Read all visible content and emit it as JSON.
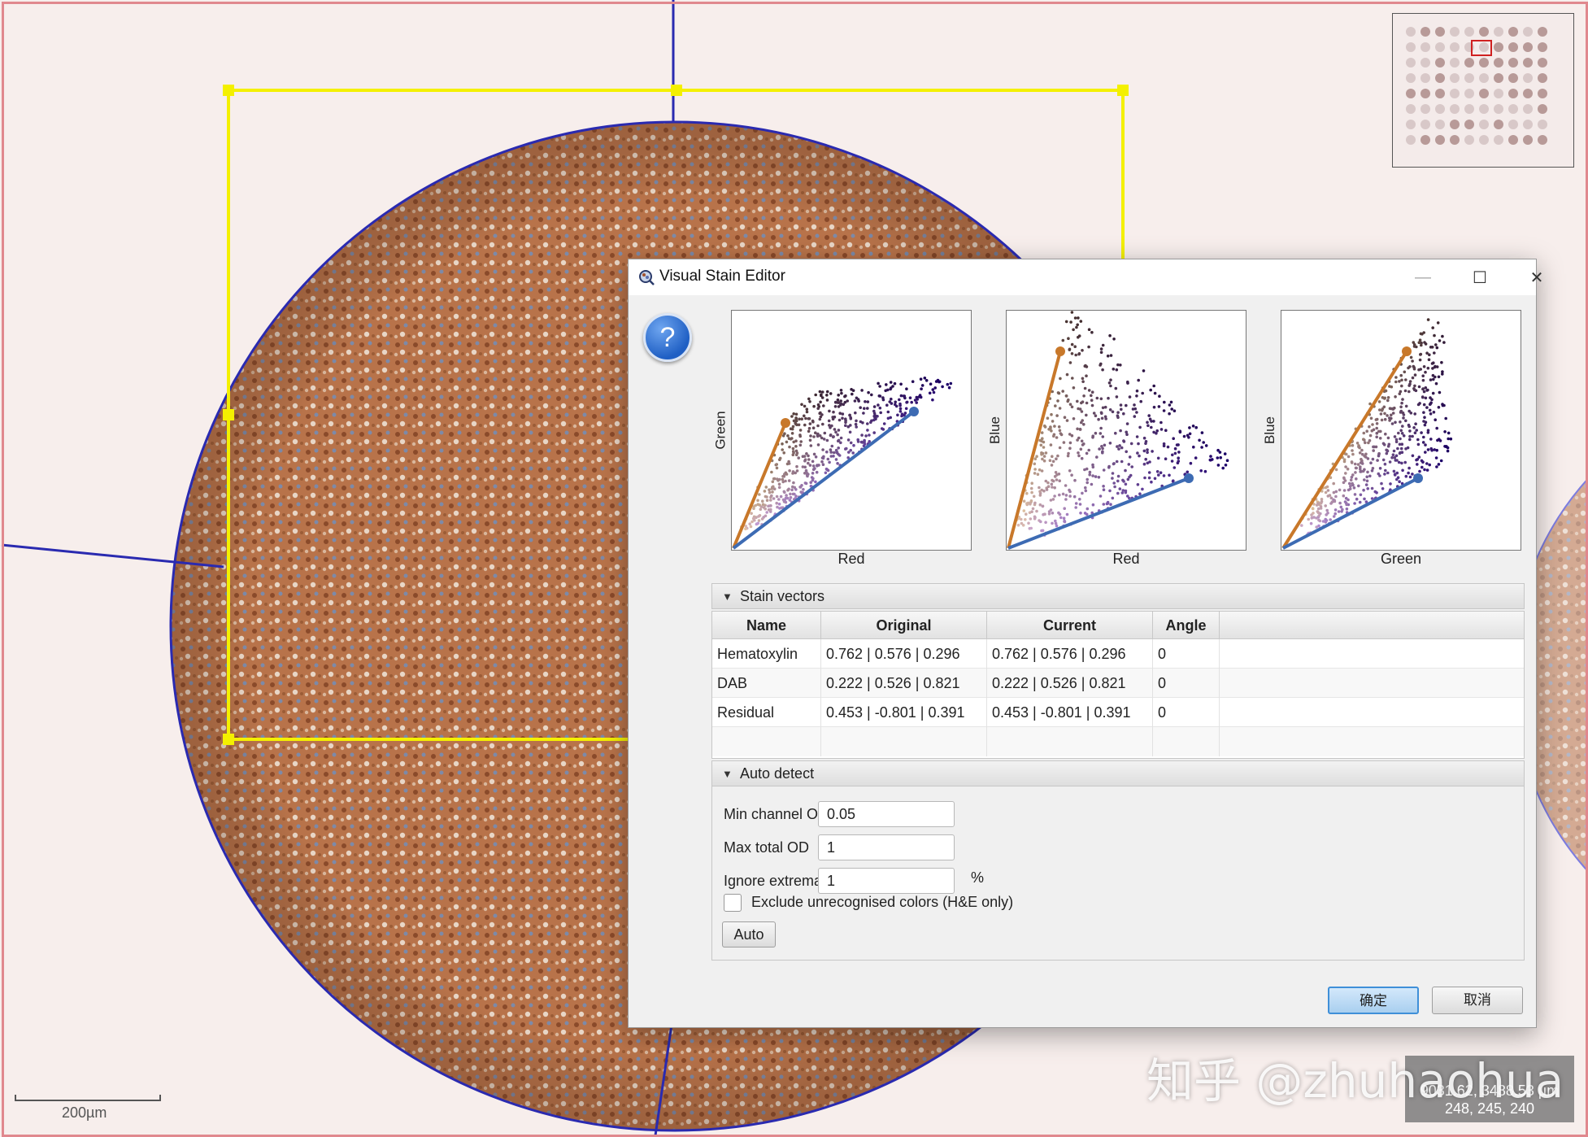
{
  "viewer": {
    "scalebar_label": "200µm",
    "coords_line1": "9031.62, 3488.53 µm",
    "coords_line2": "248, 245, 240",
    "watermark": "知乎 @zhuhaohua"
  },
  "dialog": {
    "title": "Visual Stain Editor",
    "help_label": "?",
    "minimize_glyph": "—",
    "maximize_glyph": "☐",
    "close_glyph": "✕"
  },
  "plots": [
    {
      "xlabel": "Red",
      "ylabel": "Green"
    },
    {
      "xlabel": "Red",
      "ylabel": "Blue"
    },
    {
      "xlabel": "Green",
      "ylabel": "Blue"
    }
  ],
  "stain_vectors": {
    "section_label": "Stain vectors",
    "columns": [
      "Name",
      "Original",
      "Current",
      "Angle"
    ],
    "rows": [
      {
        "name": "Hematoxylin",
        "original": "0.762 | 0.576 | 0.296",
        "current": "0.762 | 0.576 | 0.296",
        "angle": "0"
      },
      {
        "name": "DAB",
        "original": "0.222 | 0.526 | 0.821",
        "current": "0.222 | 0.526 | 0.821",
        "angle": "0"
      },
      {
        "name": "Residual",
        "original": "0.453 | -0.801 | 0.391",
        "current": "0.453 | -0.801 | 0.391",
        "angle": "0"
      }
    ]
  },
  "auto_detect": {
    "section_label": "Auto detect",
    "min_channel_od_label": "Min channel OD",
    "min_channel_od_value": "0.05",
    "max_total_od_label": "Max total OD",
    "max_total_od_value": "1",
    "ignore_extrema_label": "Ignore extrema",
    "ignore_extrema_value": "1",
    "ignore_extrema_unit": "%",
    "exclude_label": "Exclude unrecognised colors (H&E only)",
    "exclude_checked": false,
    "auto_button": "Auto"
  },
  "buttons": {
    "ok": "确定",
    "cancel": "取消"
  }
}
